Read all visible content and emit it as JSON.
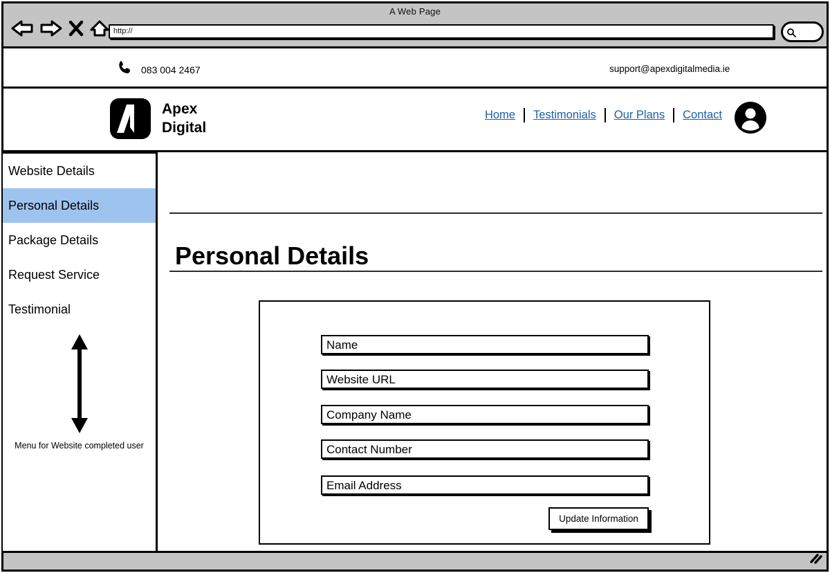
{
  "browser": {
    "window_title": "A Web Page",
    "url_value": "http://",
    "nav_icons": [
      "back-arrow-icon",
      "forward-arrow-icon",
      "close-x-icon",
      "home-icon"
    ],
    "search_icon": "magnifier-icon",
    "resize_grip": "resize-grip-icon"
  },
  "topbar": {
    "phone_icon": "phone-handset-icon",
    "phone": "083 004 2467",
    "email": "support@apexdigitalmedia.ie"
  },
  "header": {
    "logo_icon": "apex-a-logo-icon",
    "brand_line1": "Apex",
    "brand_line2": "Digital",
    "avatar_icon": "user-avatar-icon",
    "nav": [
      {
        "label": "Home"
      },
      {
        "label": "Testimonials"
      },
      {
        "label": "Our Plans"
      },
      {
        "label": "Contact"
      }
    ]
  },
  "sidebar": {
    "items": [
      {
        "label": "Website Details",
        "active": false
      },
      {
        "label": "Personal Details",
        "active": true
      },
      {
        "label": "Package Details",
        "active": false
      },
      {
        "label": "Request Service",
        "active": false
      },
      {
        "label": "Testimonial",
        "active": false
      }
    ],
    "arrow_icon": "double-headed-vertical-arrow-icon",
    "caption": "Menu for Website completed user",
    "active_color": "#9fc3ef"
  },
  "main": {
    "page_title": "Personal Details",
    "form": {
      "fields": [
        {
          "label": "Name",
          "value": "Name"
        },
        {
          "label": "Website URL",
          "value": "Website URL"
        },
        {
          "label": "Company Name",
          "value": "Company Name"
        },
        {
          "label": "Contact Number",
          "value": "Contact Number"
        },
        {
          "label": "Email Address",
          "value": "Email Address"
        }
      ],
      "submit_label": "Update Information"
    }
  },
  "colors": {
    "link": "#1a5fa8",
    "chrome": "#c4c4c4",
    "highlight": "#9fc3ef",
    "ink": "#000000"
  }
}
